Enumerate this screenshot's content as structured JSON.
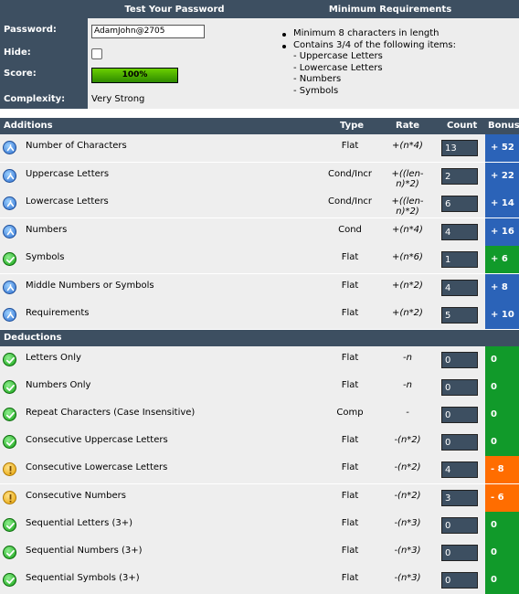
{
  "header": {
    "test_title": "Test Your Password",
    "requirements_title": "Minimum Requirements"
  },
  "form": {
    "password_label": "Password:",
    "password_value": "AdamJohn@2705",
    "hide_label": "Hide:",
    "hide_checked": false,
    "score_label": "Score:",
    "score_text": "100%",
    "score_fraction": 1.0,
    "complexity_label": "Complexity:",
    "complexity_value": "Very Strong"
  },
  "requirements": {
    "items": [
      "Minimum 8 characters in length",
      "Contains 3/4 of the following items:"
    ],
    "subitems": [
      "- Uppercase Letters",
      "- Lowercase Letters",
      "- Numbers",
      "- Symbols"
    ]
  },
  "additions": {
    "title": "Additions",
    "columns": {
      "type": "Type",
      "rate": "Rate",
      "count": "Count",
      "bonus": "Bonus"
    },
    "rows": [
      {
        "icon": "info-icon",
        "name": "Number of Characters",
        "type": "Flat",
        "rate": "+(n*4)",
        "count": "13",
        "bonus": "+ 52",
        "bonus_color": "#2b63b8"
      },
      {
        "icon": "info-icon",
        "name": "Uppercase Letters",
        "type": "Cond/Incr",
        "rate": "+((len-n)*2)",
        "count": "2",
        "bonus": "+ 22",
        "bonus_color": "#2b63b8"
      },
      {
        "icon": "info-icon",
        "name": "Lowercase Letters",
        "type": "Cond/Incr",
        "rate": "+((len-n)*2)",
        "count": "6",
        "bonus": "+ 14",
        "bonus_color": "#2b63b8"
      },
      {
        "icon": "info-icon",
        "name": "Numbers",
        "type": "Cond",
        "rate": "+(n*4)",
        "count": "4",
        "bonus": "+ 16",
        "bonus_color": "#2b63b8"
      },
      {
        "icon": "check-icon",
        "name": "Symbols",
        "type": "Flat",
        "rate": "+(n*6)",
        "count": "1",
        "bonus": "+ 6",
        "bonus_color": "#119a2a"
      },
      {
        "icon": "info-icon",
        "name": "Middle Numbers or Symbols",
        "type": "Flat",
        "rate": "+(n*2)",
        "count": "4",
        "bonus": "+ 8",
        "bonus_color": "#2b63b8"
      },
      {
        "icon": "info-icon",
        "name": "Requirements",
        "type": "Flat",
        "rate": "+(n*2)",
        "count": "5",
        "bonus": "+ 10",
        "bonus_color": "#2b63b8"
      }
    ]
  },
  "deductions": {
    "title": "Deductions",
    "rows": [
      {
        "icon": "check-icon",
        "name": "Letters Only",
        "type": "Flat",
        "rate": "-n",
        "count": "0",
        "bonus": "0",
        "bonus_color": "#119a2a"
      },
      {
        "icon": "check-icon",
        "name": "Numbers Only",
        "type": "Flat",
        "rate": "-n",
        "count": "0",
        "bonus": "0",
        "bonus_color": "#119a2a"
      },
      {
        "icon": "check-icon",
        "name": "Repeat Characters (Case Insensitive)",
        "type": "Comp",
        "rate": "-",
        "count": "0",
        "bonus": "0",
        "bonus_color": "#119a2a"
      },
      {
        "icon": "check-icon",
        "name": "Consecutive Uppercase Letters",
        "type": "Flat",
        "rate": "-(n*2)",
        "count": "0",
        "bonus": "0",
        "bonus_color": "#119a2a"
      },
      {
        "icon": "warning-icon",
        "name": "Consecutive Lowercase Letters",
        "type": "Flat",
        "rate": "-(n*2)",
        "count": "4",
        "bonus": "- 8",
        "bonus_color": "#ff6d00"
      },
      {
        "icon": "warning-icon",
        "name": "Consecutive Numbers",
        "type": "Flat",
        "rate": "-(n*2)",
        "count": "3",
        "bonus": "- 6",
        "bonus_color": "#ff6d00"
      },
      {
        "icon": "check-icon",
        "name": "Sequential Letters (3+)",
        "type": "Flat",
        "rate": "-(n*3)",
        "count": "0",
        "bonus": "0",
        "bonus_color": "#119a2a"
      },
      {
        "icon": "check-icon",
        "name": "Sequential Numbers (3+)",
        "type": "Flat",
        "rate": "-(n*3)",
        "count": "0",
        "bonus": "0",
        "bonus_color": "#119a2a"
      },
      {
        "icon": "check-icon",
        "name": "Sequential Symbols (3+)",
        "type": "Flat",
        "rate": "-(n*3)",
        "count": "0",
        "bonus": "0",
        "bonus_color": "#119a2a"
      }
    ]
  }
}
